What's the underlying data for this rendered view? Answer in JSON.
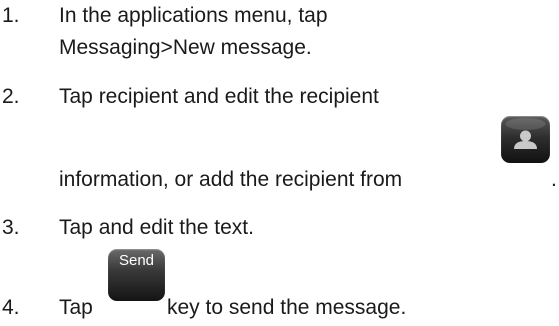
{
  "steps": [
    {
      "number": "1.",
      "lines": [
        "In the applications menu, tap",
        "Messaging>New message."
      ]
    },
    {
      "number": "2.",
      "lines": [
        "Tap recipient and edit the recipient",
        "information, or add the recipient from"
      ],
      "trailing": "."
    },
    {
      "number": "3.",
      "lines": [
        "Tap and edit the text."
      ]
    },
    {
      "number": "4.",
      "lead": "Tap",
      "button_label": "Send",
      "tail": "key to send the message."
    }
  ],
  "icons": {
    "contact": "contact-person-icon"
  }
}
